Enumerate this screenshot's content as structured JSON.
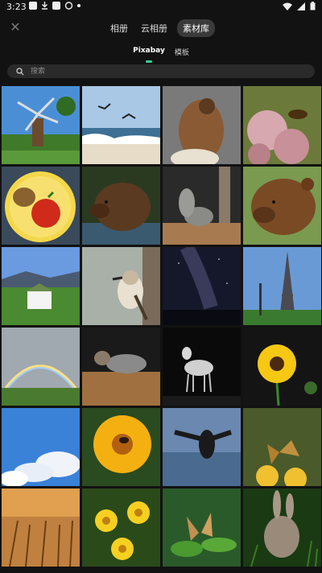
{
  "status": {
    "time": "3:23"
  },
  "tabs": [
    "相册",
    "云相册",
    "素材库"
  ],
  "subtabs": [
    "Pixabay",
    "模板"
  ],
  "search": {
    "placeholder": "搜索"
  },
  "colors": {
    "accent": "#2ed0a0",
    "background": "#121212"
  },
  "grid": {
    "photos": [
      {
        "subject": "windmill"
      },
      {
        "subject": "gulls-over-waves"
      },
      {
        "subject": "owl-closeup"
      },
      {
        "subject": "bee-on-pink-flowers"
      },
      {
        "subject": "apple-and-potato-on-plate"
      },
      {
        "subject": "brown-bear-in-water"
      },
      {
        "subject": "squirrel-on-fence"
      },
      {
        "subject": "brown-bear-portrait"
      },
      {
        "subject": "farmhouse-in-field"
      },
      {
        "subject": "kookaburra-on-branch"
      },
      {
        "subject": "milky-way-night"
      },
      {
        "subject": "eiffel-tower"
      },
      {
        "subject": "rainbow-over-field"
      },
      {
        "subject": "squirrel-on-log"
      },
      {
        "subject": "deer-black-white"
      },
      {
        "subject": "yellow-flower"
      },
      {
        "subject": "clouds-blue-sky"
      },
      {
        "subject": "bee-on-yellow-flower"
      },
      {
        "subject": "bird-over-water"
      },
      {
        "subject": "butterfly-on-flowers"
      },
      {
        "subject": "wheat-field"
      },
      {
        "subject": "yellow-daisies"
      },
      {
        "subject": "butterfly-on-leaves"
      },
      {
        "subject": "rabbit-in-grass"
      }
    ]
  }
}
